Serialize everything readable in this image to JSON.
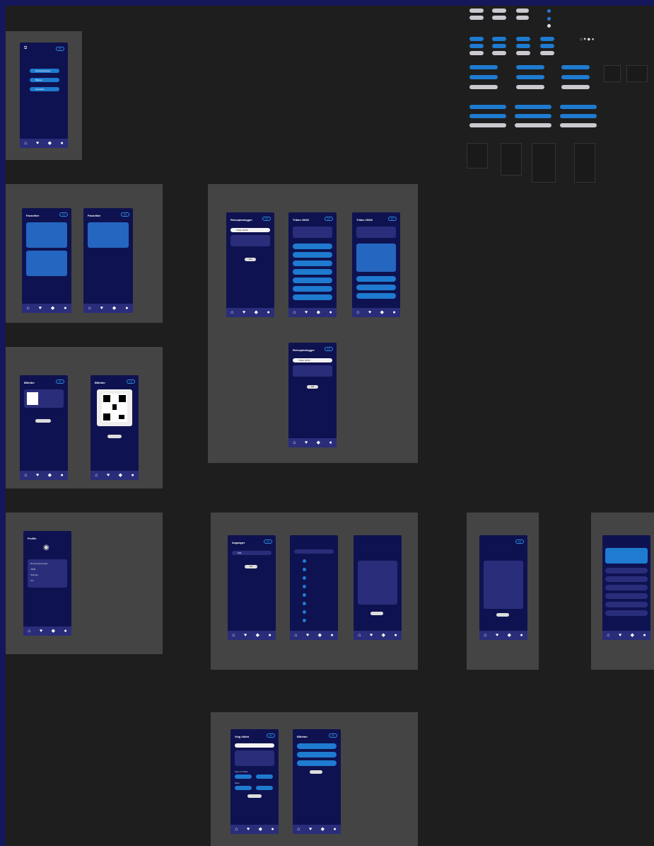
{
  "canvas": {
    "background": "#1e1e1e",
    "border": "#14175a"
  },
  "colors": {
    "phone_bg": "#0f1250",
    "nav_bg": "#2a2d7a",
    "accent": "#1e7bd0",
    "frame": "#444444"
  },
  "icons": [
    "home-icon",
    "heart-icon",
    "ticket-icon",
    "user-icon"
  ],
  "screens": {
    "home": {
      "buttons": [
        "Reiseplanlegger",
        "Billetter",
        "Favoritter"
      ]
    },
    "favorites": {
      "title": "Favoritter"
    },
    "tickets": {
      "title": "Billetter"
    },
    "trip_planner": {
      "title": "Reiseplanlegger",
      "search_value": "Trikke 20/08",
      "action": "Søk",
      "list_title": "Trikke 20/08"
    },
    "profile": {
      "title": "Profile",
      "items": [
        "Reiseopplysninger",
        "Vilkår",
        "Settings",
        "Om"
      ]
    },
    "departures": {
      "title": "Avganger",
      "search": "Søk",
      "action": "Søk"
    },
    "ticket_select": {
      "title": "Velg billett",
      "section_1": "Type of Ticket",
      "section_2": "Zone"
    },
    "ticket_list": {
      "title": "Billetter"
    }
  }
}
